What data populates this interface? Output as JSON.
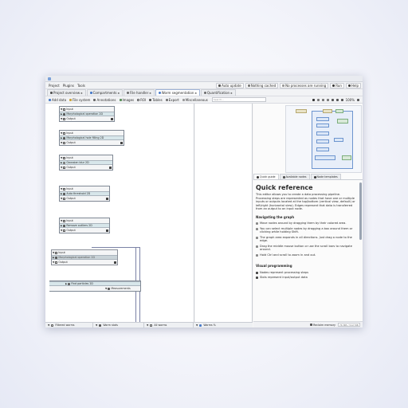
{
  "menubar": {
    "items": [
      "Project",
      "Plugins",
      "Tools"
    ],
    "right": {
      "auto_update": "Auto update",
      "cache": "Nothing cached",
      "status": "No processes are running",
      "run": "Run",
      "help": "Help"
    }
  },
  "tabs": [
    {
      "label": "Project overview"
    },
    {
      "label": "Compartments"
    },
    {
      "label": "File handler"
    },
    {
      "label": "Worm segmentation"
    },
    {
      "label": "Quantification"
    }
  ],
  "toolbar": {
    "items": [
      "Add data",
      "File system",
      "Annotations",
      "Images",
      "ROI",
      "Tables",
      "Export",
      "Miscellaneous"
    ],
    "search_placeholder": "Search...",
    "zoom": "100%"
  },
  "nodes": [
    {
      "input": "Input",
      "name": "Morphological operation 2D",
      "output": "Output"
    },
    {
      "input": "Input",
      "name": "Morphological hole filling 2D",
      "output": "Output"
    },
    {
      "input": "Input",
      "name": "Gaussian blur 2D",
      "output": "Output"
    },
    {
      "input": "Input",
      "name": "Auto threshold 2D",
      "output": "Output"
    },
    {
      "input": "Input",
      "name": "Remove outliers 2D",
      "output": "Output"
    },
    {
      "input": "Input",
      "name": "Morphological operation 2D",
      "output": "Output"
    },
    {
      "name": "Find particles 2D",
      "output": "Measurements"
    }
  ],
  "bottom_bar": [
    "Filtered worms",
    "Worm stats",
    "All worms",
    "Worms %"
  ],
  "side_tabs": [
    "Quick guide",
    "Available nodes",
    "Node templates"
  ],
  "quick_reference": {
    "title": "Quick reference",
    "intro": "This editor allows you to create a data processing pipeline. Processing steps are represented as nodes that have one or multiple inputs or outputs located at the top/bottom (vertical view, default) or left/right (horizontal view). Edges represent that data is transferred from an output to an input node.",
    "nav_heading": "Navigating the graph",
    "nav_items": [
      "Move nodes around by dragging them by their colored area.",
      "You can select multiple nodes by dragging a box around them or clicking while holding Shift.",
      "The graph area expands in all directions. Just drag a node to the edge.",
      "Drag the middle mouse button or use the scroll bars to navigate around.",
      "Hold Ctrl and scroll to zoom in and out."
    ],
    "vp_heading": "Visual programming",
    "vp_items": [
      "Nodes represent processing steps",
      "Slots represent input/output data"
    ]
  },
  "memory": {
    "label": "Reclaim memory",
    "value": "76 MB / 512 MB"
  },
  "colors": {
    "accent": "#4a7bc8",
    "node_mid": "#d7e6ea",
    "connector": "#7b82a6"
  }
}
